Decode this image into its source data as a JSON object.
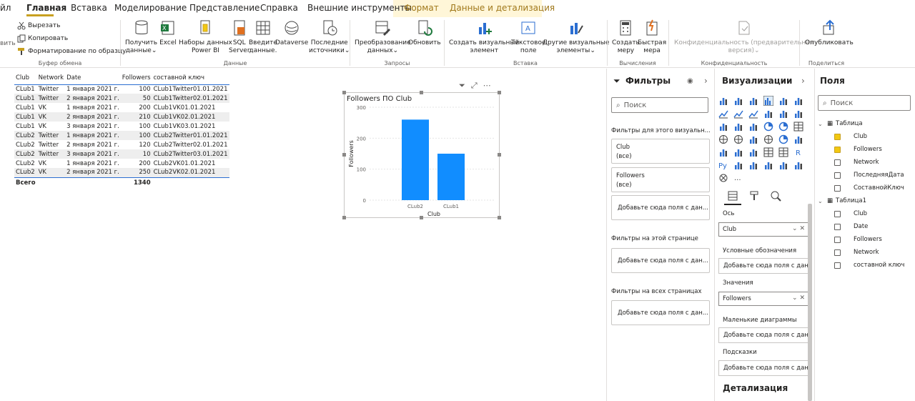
{
  "tabs": [
    {
      "label": "йл"
    },
    {
      "label": "Главная"
    },
    {
      "label": "Вставка"
    },
    {
      "label": "Моделирование"
    },
    {
      "label": "Представление"
    },
    {
      "label": "Справка"
    },
    {
      "label": "Внешние инструменты"
    },
    {
      "label": "Формат"
    },
    {
      "label": "Данные и детализация"
    }
  ],
  "ribbon": {
    "clipboard": {
      "cut": "Вырезать",
      "copy": "Копировать",
      "format_painter": "Форматирование по образцу",
      "group": "Буфер обмена",
      "paste_fragment": "вить"
    },
    "data": {
      "get_data": [
        "Получить",
        "данные"
      ],
      "excel": "Excel",
      "datasets": [
        "Наборы данных",
        "Power BI"
      ],
      "sql": [
        "SQL",
        "Server"
      ],
      "enter": [
        "Введите",
        "данные."
      ],
      "dataverse": "Dataverse",
      "recent": [
        "Последние",
        "источники"
      ],
      "group": "Данные"
    },
    "queries": {
      "transform": [
        "Преобразование",
        "данных"
      ],
      "refresh": "Обновить",
      "group": "Запросы"
    },
    "insert": {
      "new_visual": [
        "Создать визуальный",
        "элемент"
      ],
      "textbox": [
        "Текстовое",
        "поле"
      ],
      "more_visuals": [
        "Другие визуальные",
        "элементы"
      ],
      "group": "Вставка"
    },
    "calc": {
      "new_measure": [
        "Создать",
        "меру"
      ],
      "quick_measure": [
        "Быстрая",
        "мера"
      ],
      "group": "Вычисления"
    },
    "sensitivity": {
      "label": [
        "Конфиденциальность (предварительная",
        "версия)"
      ],
      "group": "Конфиденциальность"
    },
    "share": {
      "publish": "Опубликовать",
      "group": "Поделиться"
    }
  },
  "table": {
    "headers": [
      "Club",
      "Network",
      "Date",
      "Followers",
      "составной ключ"
    ],
    "rows": [
      [
        "CLub1",
        "Twitter",
        "1 января 2021 г.",
        "100",
        "CLub1Twitter01.01.2021"
      ],
      [
        "CLub1",
        "Twitter",
        "2 января 2021 г.",
        "50",
        "CLub1Twitter02.01.2021"
      ],
      [
        "CLub1",
        "VK",
        "1 января 2021 г.",
        "200",
        "CLub1VK01.01.2021"
      ],
      [
        "CLub1",
        "VK",
        "2 января 2021 г.",
        "210",
        "CLub1VK02.01.2021"
      ],
      [
        "CLub1",
        "VK",
        "3 января 2021 г.",
        "100",
        "CLub1VK03.01.2021"
      ],
      [
        "CLub2",
        "Twitter",
        "1 января 2021 г.",
        "100",
        "CLub2Twitter01.01.2021"
      ],
      [
        "CLub2",
        "Twitter",
        "2 января 2021 г.",
        "120",
        "CLub2Twitter02.01.2021"
      ],
      [
        "CLub2",
        "Twitter",
        "3 января 2021 г.",
        "10",
        "CLub2Twitter03.01.2021"
      ],
      [
        "CLub2",
        "VK",
        "1 января 2021 г.",
        "200",
        "CLub2VK01.01.2021"
      ],
      [
        "CLub2",
        "VK",
        "2 января 2021 г.",
        "250",
        "CLub2VK02.01.2021"
      ]
    ],
    "total_label": "Всего",
    "total_value": "1340"
  },
  "chart_data": {
    "type": "bar",
    "title": "Followers ПО Club",
    "xlabel": "Club",
    "ylabel": "Followers",
    "categories": [
      "CLub2",
      "CLub1"
    ],
    "values": [
      260,
      150
    ],
    "yticks": [
      "0",
      "100",
      "200",
      "300"
    ],
    "ylim": [
      0,
      300
    ],
    "grid": true,
    "color": "#118dff"
  },
  "filters": {
    "title": "Фильтры",
    "search_placeholder": "Поиск",
    "visual_section": "Фильтры для этого визуальн...",
    "card1_field": "Club",
    "card1_value": "(все)",
    "card2_field": "Followers",
    "card2_value": "(все)",
    "drop_text": "Добавьте сюда поля с дан...",
    "page_section": "Фильтры на этой странице",
    "all_section": "Фильтры на всех страницах"
  },
  "viz": {
    "title": "Визуализации",
    "axis_label": "Ось",
    "axis_value": "Club",
    "legend_label": "Условные обозначения",
    "values_label": "Значения",
    "values_value": "Followers",
    "small_multiples_label": "Маленькие диаграммы",
    "tooltips_label": "Подсказки",
    "drop_text": "Добавьте сюда поля с дан...",
    "drillthrough": "Детализация",
    "py_label": "Py",
    "r_label": "R",
    "more": "..."
  },
  "fields": {
    "title": "Поля",
    "search_placeholder": "Поиск",
    "table1": "Таблица",
    "table1_fields": [
      {
        "name": "Club",
        "checked": true
      },
      {
        "name": "Followers",
        "checked": true
      },
      {
        "name": "Network",
        "checked": false
      },
      {
        "name": "ПоследняяДата",
        "checked": false
      },
      {
        "name": "СоставнойКлюч",
        "checked": false
      }
    ],
    "table2": "Таблица1",
    "table2_fields": [
      {
        "name": "Club",
        "checked": false
      },
      {
        "name": "Date",
        "checked": false
      },
      {
        "name": "Followers",
        "checked": false
      },
      {
        "name": "Network",
        "checked": false
      },
      {
        "name": "составной ключ",
        "checked": false
      }
    ]
  },
  "colors": {
    "accent": "#f2c811",
    "bar": "#118dff",
    "table_accent": "#2b6ed1"
  }
}
